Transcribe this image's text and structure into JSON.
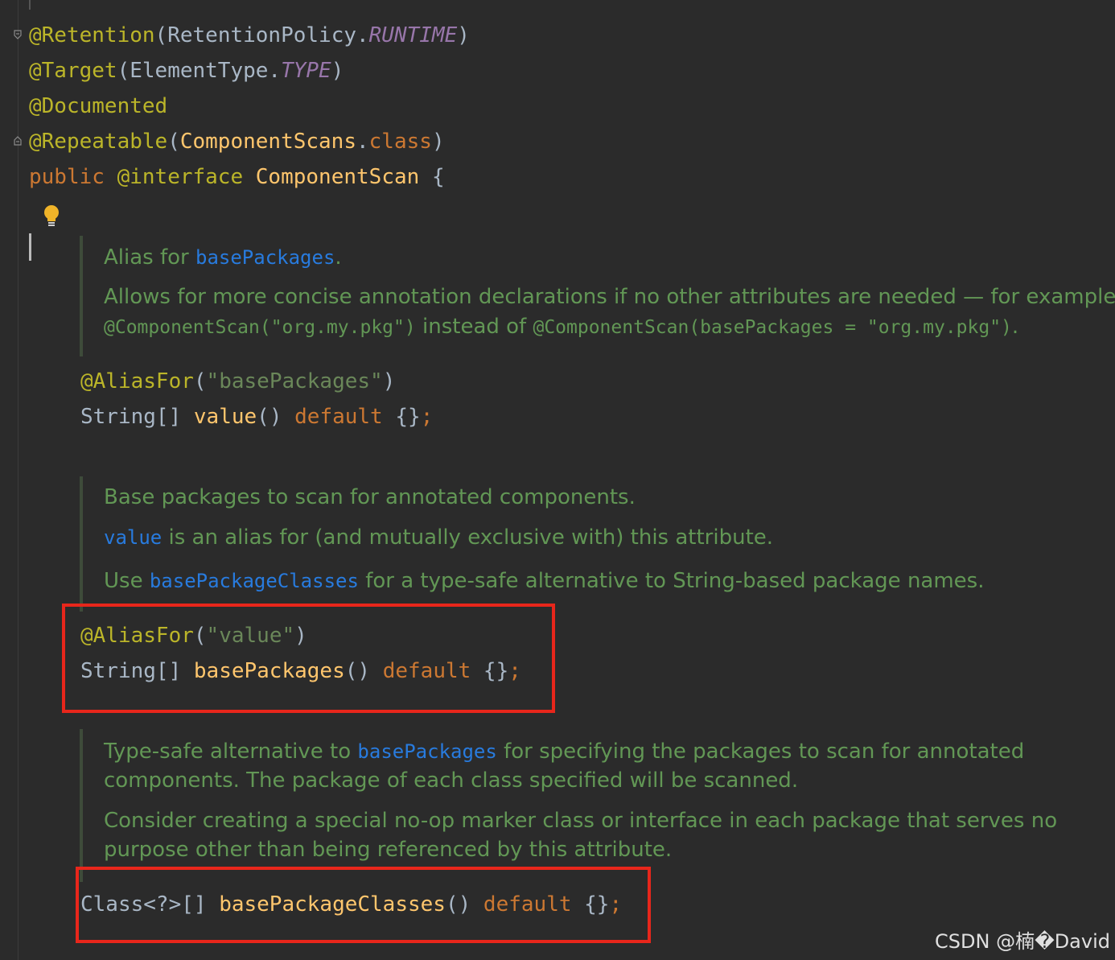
{
  "code": {
    "retention": {
      "ann": "@Retention",
      "open": "(RetentionPolicy.",
      "const": "RUNTIME",
      "close": ")"
    },
    "target": {
      "ann": "@Target",
      "open": "(ElementType.",
      "const": "TYPE",
      "close": ")"
    },
    "documented": {
      "ann": "@Documented"
    },
    "repeatable": {
      "ann": "@Repeatable",
      "open": "(",
      "arg": "ComponentScans",
      "dot": ".",
      "kw": "class",
      "close": ")"
    },
    "declaration": {
      "kw1": "public",
      "kw2": "@interface",
      "name": "ComponentScan",
      "brace": "{"
    }
  },
  "doc1": {
    "line1_pre": "Alias for ",
    "line1_ref": "basePackages",
    "line1_post": ".",
    "line2": "Allows for more concise annotation declarations if no other attributes are needed — for example,",
    "line3_code1": "@ComponentScan(\"org.my.pkg\")",
    "line3_mid": " instead of ",
    "line3_code2": "@ComponentScan(basePackages = \"org.my.pkg\")",
    "line3_post": "."
  },
  "member1": {
    "ann": "@AliasFor",
    "ann_open": "(",
    "ann_str": "\"basePackages\"",
    "ann_close": ")",
    "type": "String[] ",
    "name": "value",
    "parens": "() ",
    "kw": "default",
    "tail": " {}",
    "semi": ";"
  },
  "doc2": {
    "line1": "Base packages to scan for annotated components.",
    "line2_ref": "value",
    "line2_post": " is an alias for (and mutually exclusive with) this attribute.",
    "line3_pre": "Use ",
    "line3_ref": "basePackageClasses",
    "line3_post": " for a type-safe alternative to String-based package names."
  },
  "member2": {
    "ann": "@AliasFor",
    "ann_open": "(",
    "ann_str": "\"value\"",
    "ann_close": ")",
    "type": "String[] ",
    "name": "basePackages",
    "parens": "() ",
    "kw": "default",
    "tail": " {}",
    "semi": ";"
  },
  "doc3": {
    "line1_pre": "Type-safe alternative to ",
    "line1_ref": "basePackages",
    "line1_post": " for specifying the packages to scan for annotated",
    "line2": "components. The package of each class specified will be scanned.",
    "line3": "Consider creating a special no-op marker class or interface in each package that serves no",
    "line4": "purpose other than being referenced by this attribute."
  },
  "member3": {
    "type": "Class<?>[] ",
    "name": "basePackageClasses",
    "parens": "() ",
    "kw": "default",
    "tail": " {}",
    "semi": ";"
  },
  "watermark": "CSDN @楠�David",
  "colors": {
    "background": "#2b2b2b",
    "annotation": "#bbb529",
    "keyword": "#cc7832",
    "string": "#6a8759",
    "method": "#ffc66d",
    "doc_text": "#629755",
    "doc_link": "#287bde",
    "highlight_box": "#e8261b"
  },
  "icons": {
    "bulb": "lightbulb-icon",
    "fold": "fold-marker-icon"
  }
}
